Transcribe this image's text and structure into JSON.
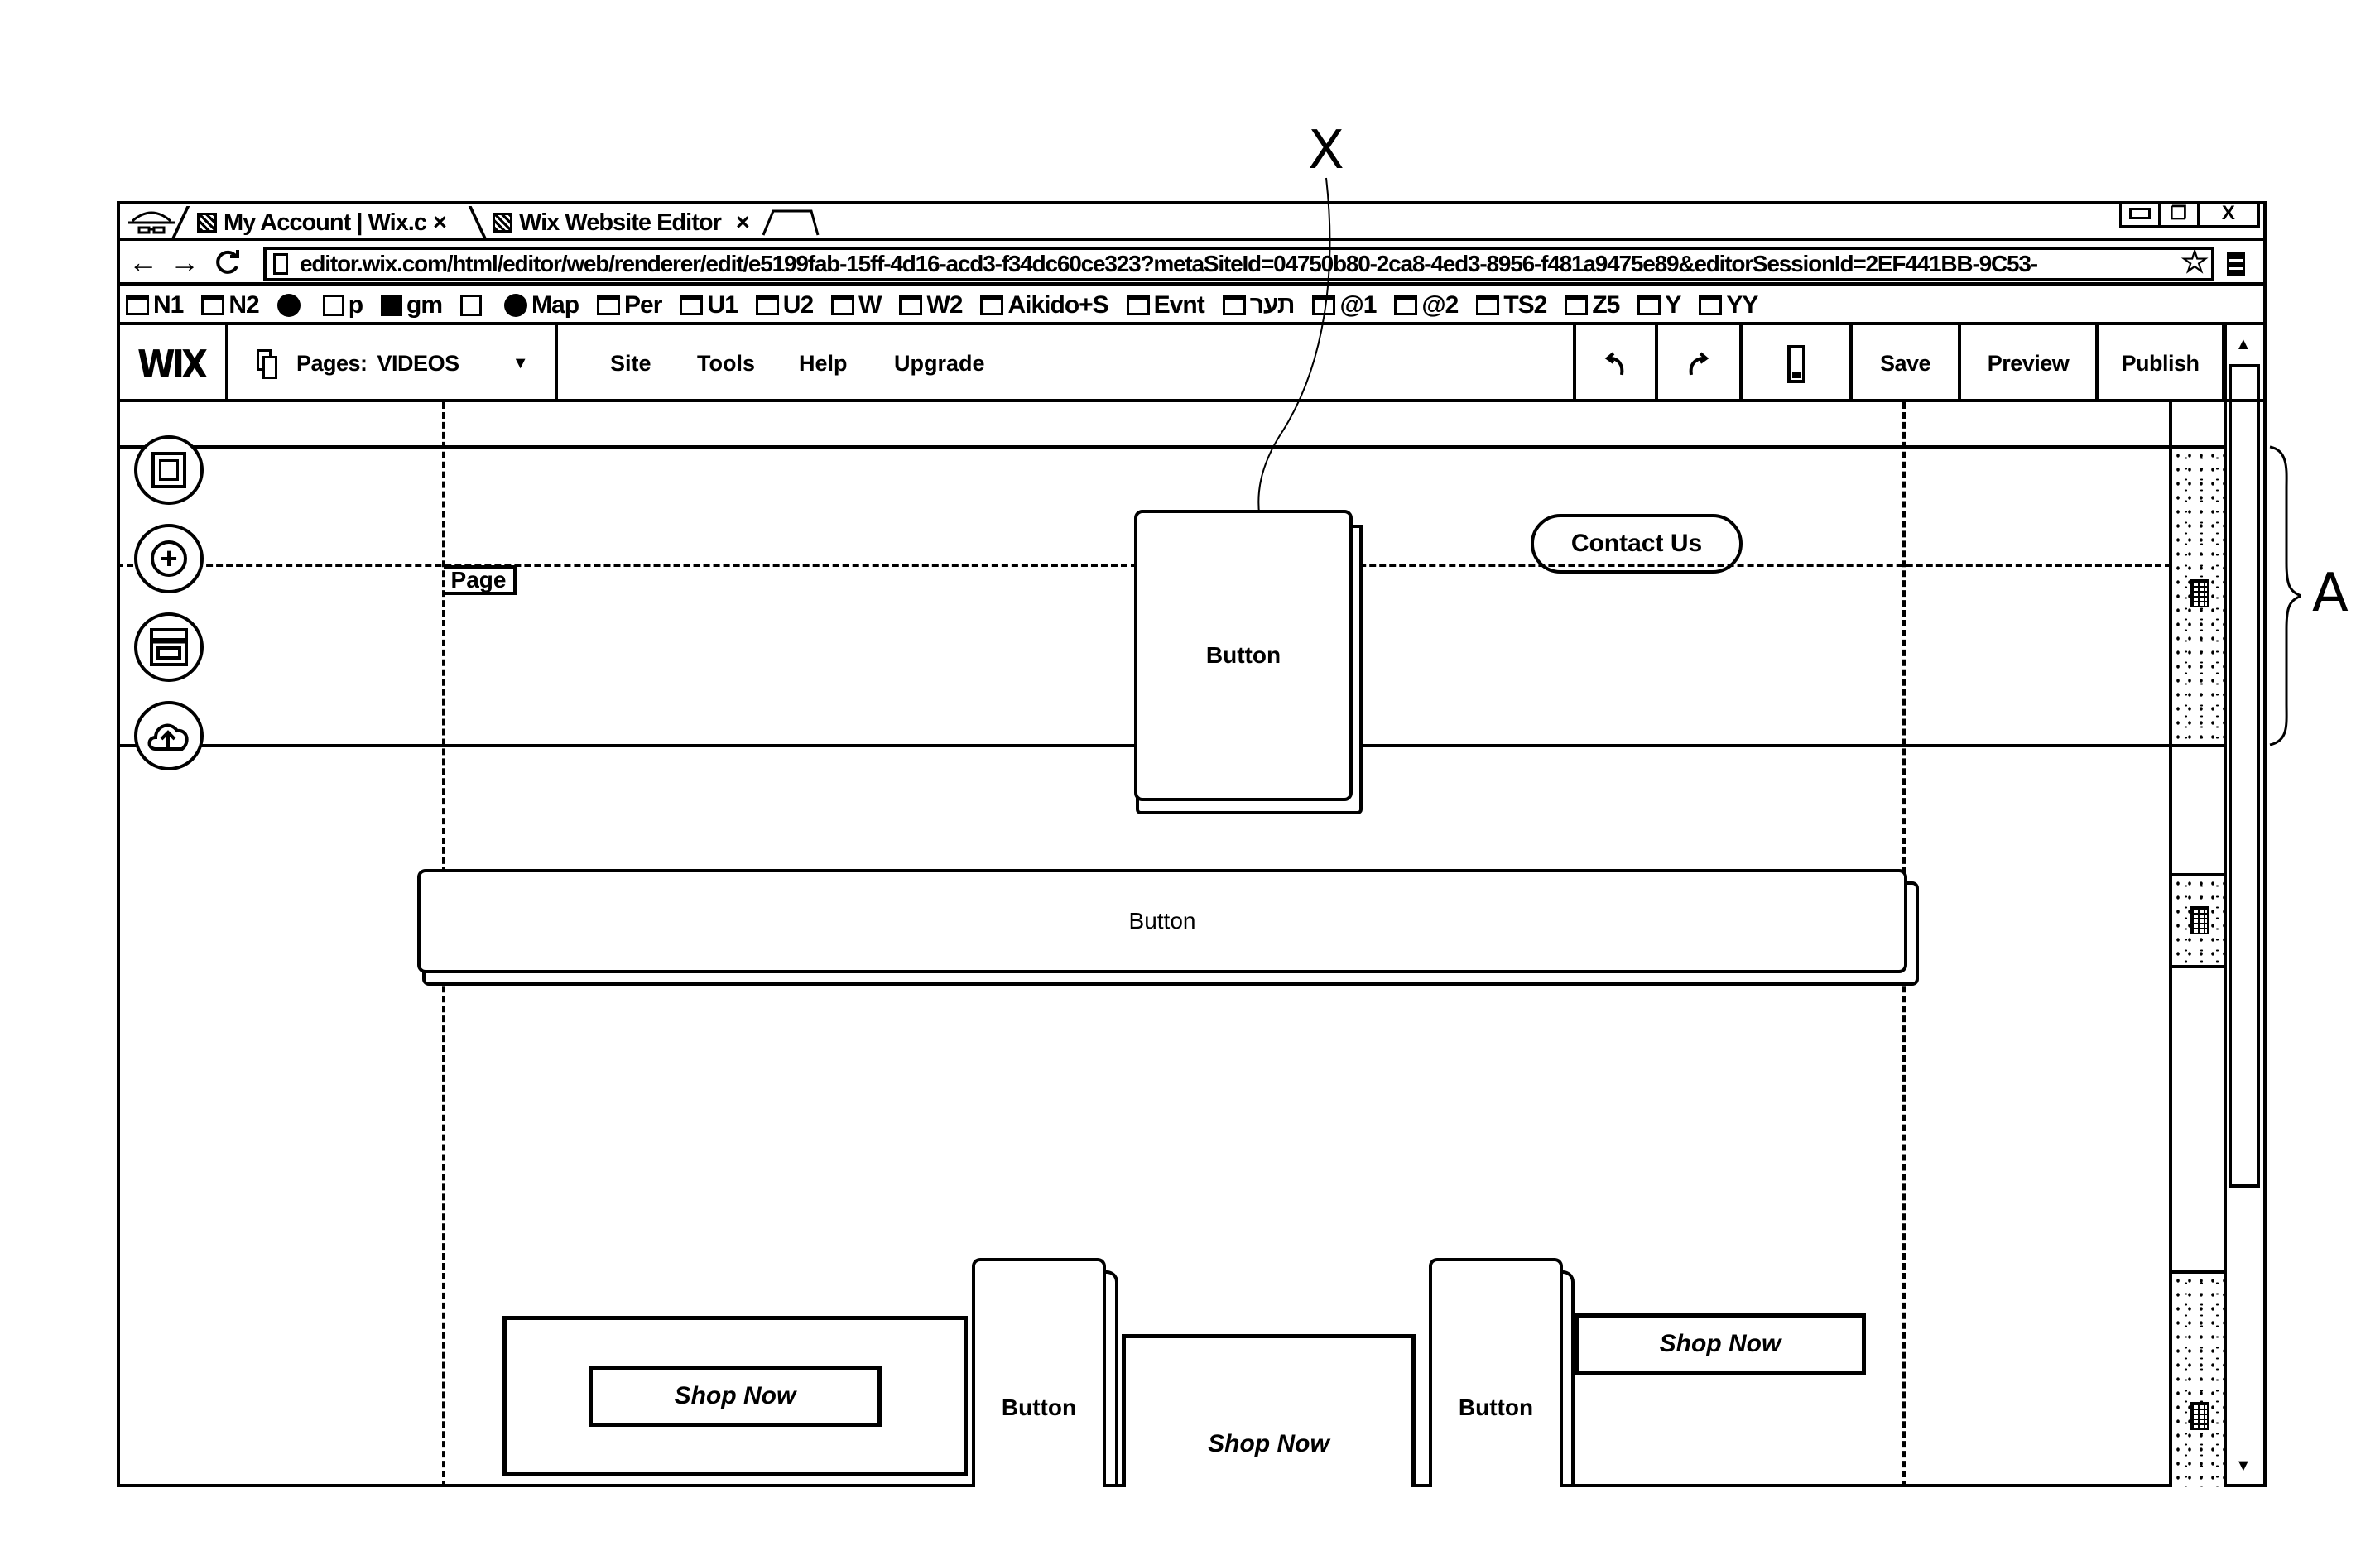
{
  "annotations": {
    "callout_x": "X",
    "callout_a": "A"
  },
  "browser": {
    "tabs": [
      {
        "label": "My Account | Wix.c",
        "close": "×",
        "active": false
      },
      {
        "label": "Wix Website Editor",
        "close": "×",
        "active": true
      }
    ],
    "window_controls": {
      "minimize": "▭",
      "restore": "❐",
      "close": "X"
    },
    "nav": {
      "back": "←",
      "forward": "→",
      "reload": "C"
    },
    "url": "editor.wix.com/html/editor/web/renderer/edit/e5199fab-15ff-4d16-acd3-f34dc60ce323?metaSiteId=04750b80-2ca8-4ed3-8956-f481a9475e89&editorSessionId=2EF441BB-9C53-",
    "star": "☆",
    "menu_icon": "≡",
    "bookmarks": [
      {
        "label": "N1",
        "icon": "folder-icon"
      },
      {
        "label": "N2",
        "icon": "folder-icon"
      },
      {
        "label": "",
        "icon": "google-icon"
      },
      {
        "label": "p",
        "icon": "google-plus-icon"
      },
      {
        "label": "gm",
        "icon": "gmail-icon"
      },
      {
        "label": "",
        "icon": "facebook-icon"
      },
      {
        "label": "Map",
        "icon": "google-icon"
      },
      {
        "label": "Per",
        "icon": "folder-icon"
      },
      {
        "label": "U1",
        "icon": "folder-icon"
      },
      {
        "label": "U2",
        "icon": "folder-icon"
      },
      {
        "label": "W",
        "icon": "folder-icon"
      },
      {
        "label": "W2",
        "icon": "folder-icon"
      },
      {
        "label": "Aikido+S",
        "icon": "folder-icon"
      },
      {
        "label": "Evnt",
        "icon": "folder-icon"
      },
      {
        "label": "תער",
        "icon": "folder-icon"
      },
      {
        "label": "@1",
        "icon": "folder-icon"
      },
      {
        "label": "@2",
        "icon": "folder-icon"
      },
      {
        "label": "TS2",
        "icon": "folder-icon"
      },
      {
        "label": "Z5",
        "icon": "folder-icon"
      },
      {
        "label": "Y",
        "icon": "folder-icon"
      },
      {
        "label": "YY",
        "icon": "folder-icon"
      }
    ]
  },
  "editor": {
    "logo": "WIX",
    "pages_label": "Pages:",
    "pages_value": "VIDEOS",
    "pages_caret": "▼",
    "menu": [
      "Site",
      "Tools",
      "Help",
      "Upgrade"
    ],
    "undo": "↶",
    "redo": "↷",
    "save": "Save",
    "preview": "Preview",
    "publish": "Publish",
    "scroll_up": "▲",
    "scroll_down": "▼",
    "side_tools": [
      "background-icon",
      "add-icon",
      "store-icon",
      "upload-icon"
    ]
  },
  "canvas": {
    "page_tag": "Page",
    "contact_button": "Contact Us",
    "header_button": "Button",
    "wide_button": "Button",
    "bottom": {
      "shop_now_1": "Shop Now",
      "button_1": "Button",
      "shop_now_2": "Shop Now",
      "button_2": "Button",
      "shop_now_3": "Shop Now"
    }
  }
}
